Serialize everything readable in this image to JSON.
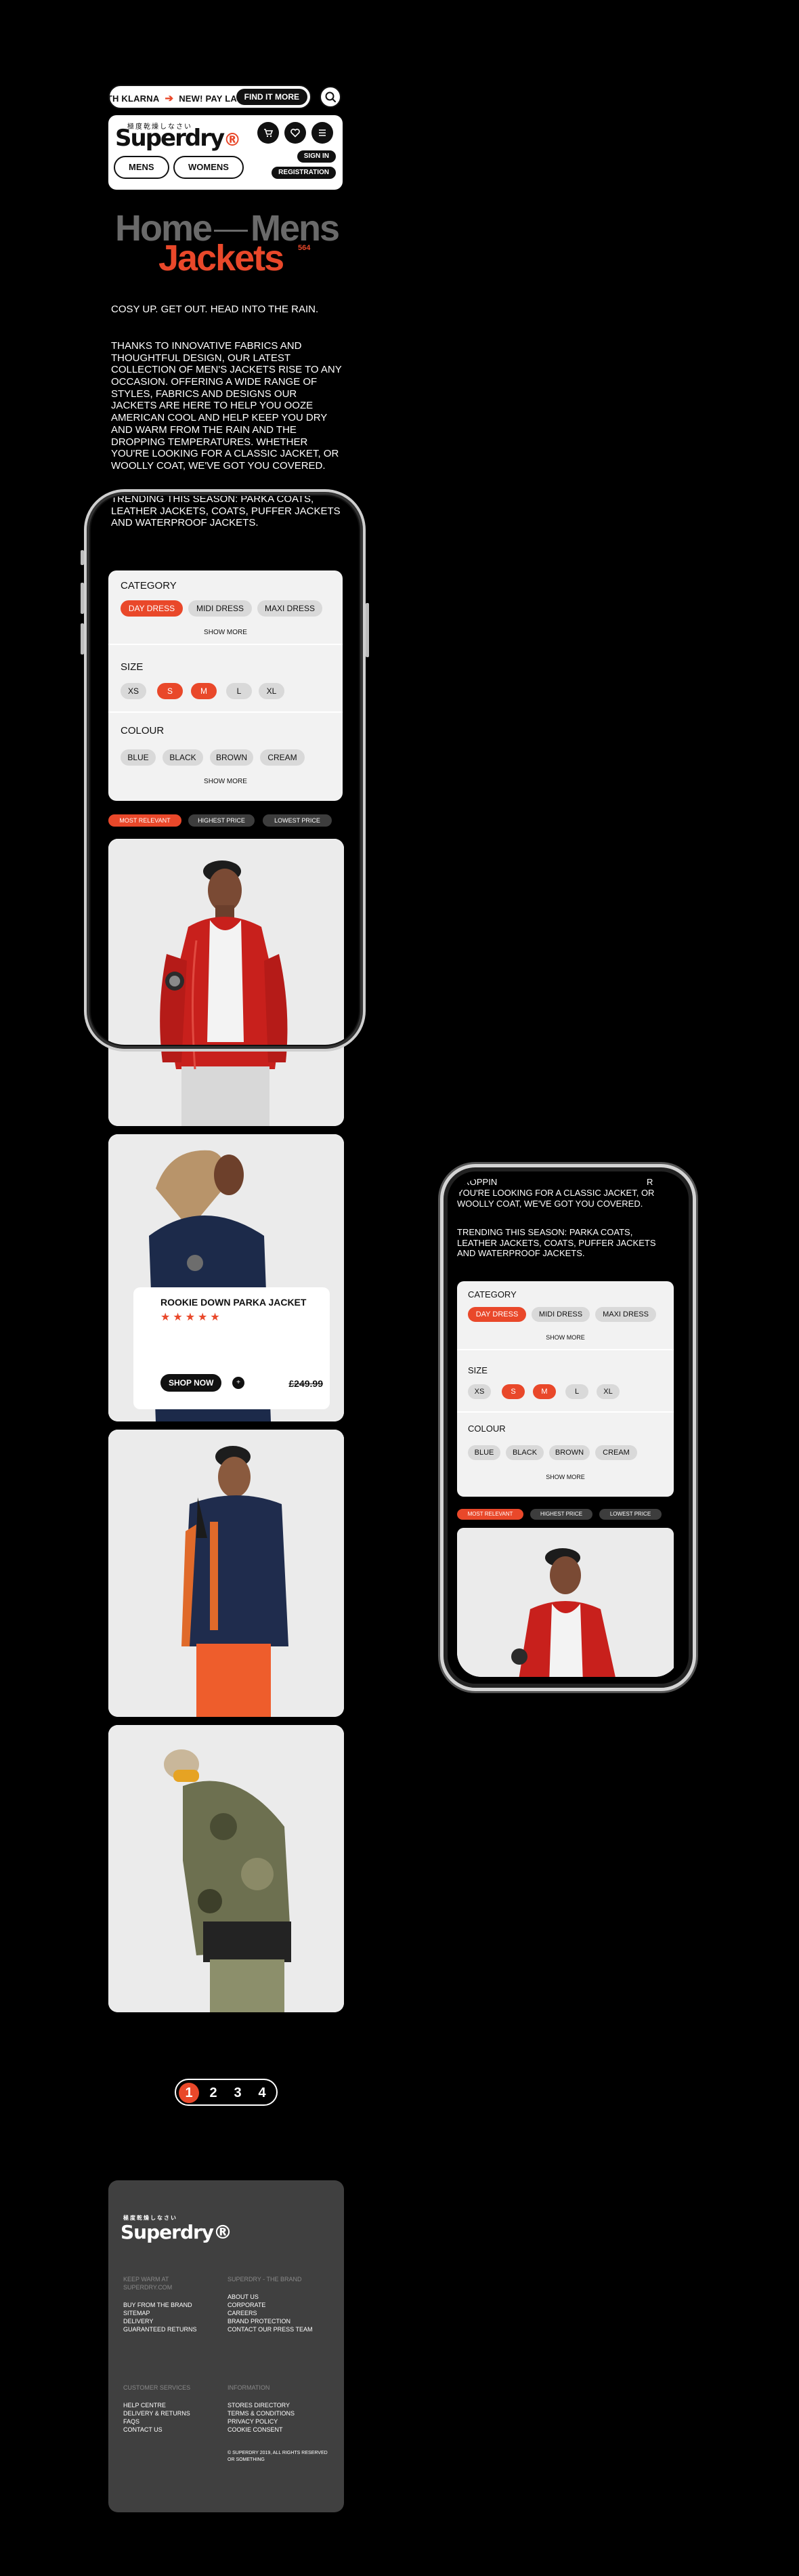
{
  "promo": {
    "ticker": "ITH KLARNA",
    "arrow": "➔",
    "message": "NEW! PAY LA",
    "cta": "FIND IT MORE"
  },
  "header": {
    "logo_jp": "極度乾燥しなさい",
    "logo": "Superdry",
    "logo_mark": "®",
    "sign_in": "SIGN IN",
    "registration": "REGISTRATION",
    "tabs": [
      "MENS",
      "WOMENS"
    ]
  },
  "breadcrumb": {
    "home": "Home",
    "section": "Mens"
  },
  "page": {
    "title": "Jackets",
    "count": "564"
  },
  "intro": {
    "lead": "Cosy up. Get out. Head into the rain.",
    "body": "Thanks to innovative fabrics and thoughtful design, our latest collection of men's jackets rise to any occasion. Offering a wide range of styles, fabrics and designs our jackets are here to help you ooze American cool and help keep you dry and warm from the rain and the dropping temperatures. Whether you're looking for a classic jacket, or woolly coat, we've got you covered.",
    "trending": "Trending this season: parka coats, leather jackets, coats, puffer jackets and waterproof jackets."
  },
  "phone_intro": {
    "partial1": "DROPPIN",
    "partial2": "R",
    "body": "You're looking for a classic jacket, or woolly coat, we've got you covered.",
    "trending": "Trending this season: parka coats, leather jackets, coats, puffer jackets and waterproof jackets."
  },
  "filters": {
    "category": {
      "label": "Category",
      "options": [
        "Day dress",
        "Midi dress",
        "Maxi dress"
      ],
      "selected": "Day dress",
      "more": "Show more"
    },
    "size": {
      "label": "Size",
      "options": [
        "XS",
        "S",
        "M",
        "L",
        "XL"
      ],
      "selected": [
        "S",
        "M"
      ]
    },
    "colour": {
      "label": "Colour",
      "options": [
        "Blue",
        "Black",
        "Brown",
        "Cream"
      ],
      "more": "Show more"
    }
  },
  "sort": {
    "options": [
      "Most relevant",
      "Highest price",
      "Lowest price"
    ],
    "selected": "Most relevant"
  },
  "product_popup": {
    "name": "Rookie down parka jacket",
    "stars": "★★★★★",
    "rating": 5,
    "shop": "Shop now",
    "plus": "+",
    "price": "£249.99"
  },
  "pagination": [
    "1",
    "2",
    "3",
    "4"
  ],
  "footer": {
    "logo_jp": "極度乾燥しなさい",
    "logo": "Superdry®",
    "col1_head": "Keep warm at Superdry.com",
    "col1_items": [
      "Buy from the brand",
      "Sitemap",
      "Delivery",
      "Guaranteed returns"
    ],
    "col2_head": "Superdry - The brand",
    "col2_items": [
      "About us",
      "Corporate",
      "Careers",
      "Brand protection",
      "Contact our press team"
    ],
    "col3_head": "Customer services",
    "col3_items": [
      "Help centre",
      "Delivery & returns",
      "FAQs",
      "Contact us"
    ],
    "col4_head": "Information",
    "col4_items": [
      "Stores directory",
      "Terms & conditions",
      "Privacy policy",
      "Cookie consent"
    ],
    "copyright": "© Superdry 2019, all rights reserved or something"
  },
  "colors": {
    "accent": "#e9482a",
    "background": "#000000",
    "panel": "#f2f2f2",
    "footer": "#404040"
  }
}
